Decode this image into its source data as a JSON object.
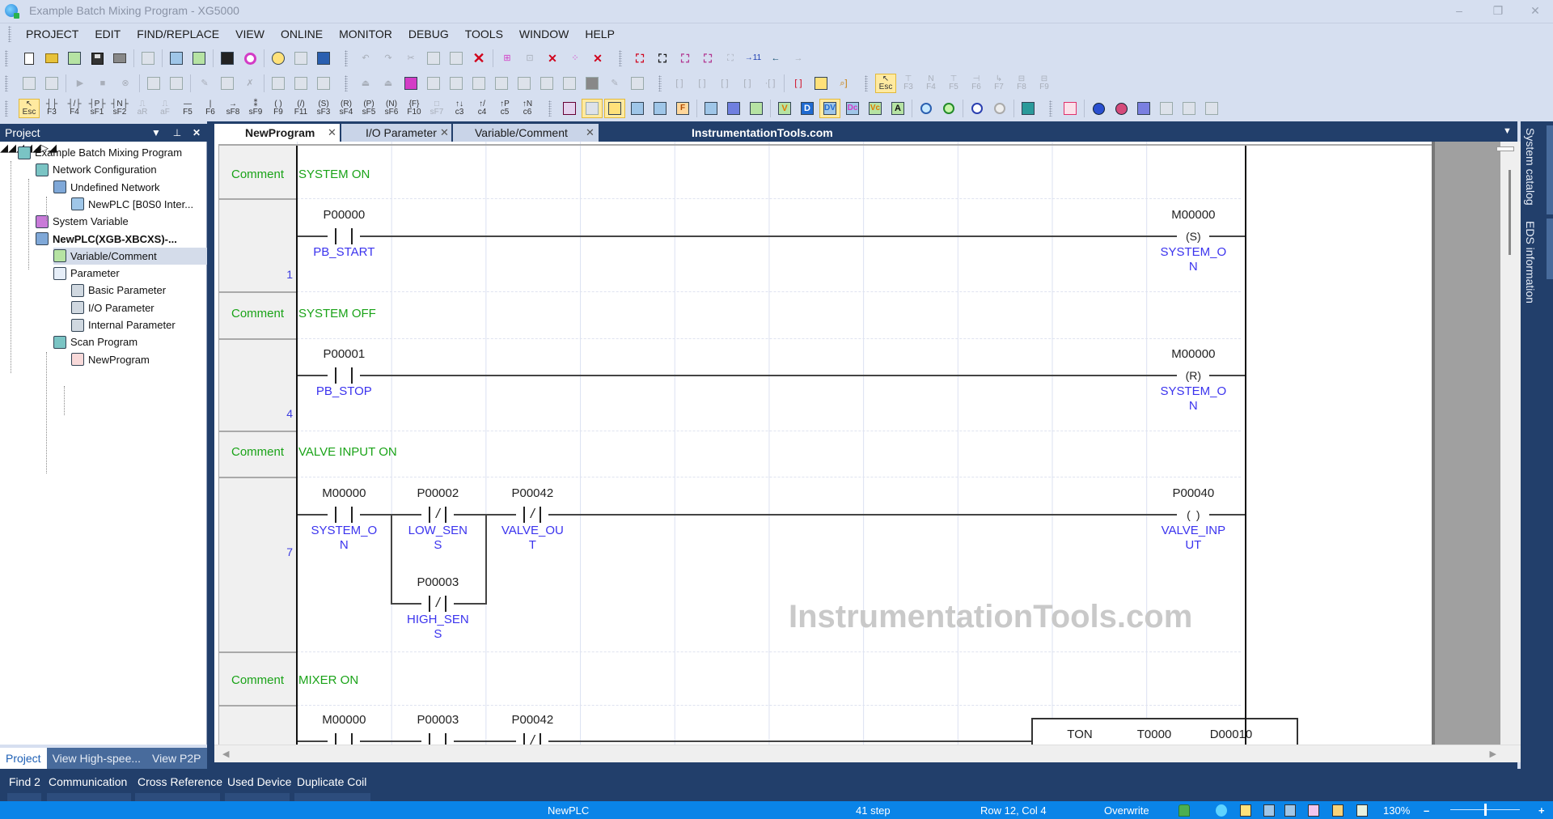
{
  "window": {
    "title": "Example  Batch Mixing Program - XG5000",
    "controls": {
      "minimize": "–",
      "restore": "❐",
      "close": "✕"
    }
  },
  "menu": [
    "PROJECT",
    "EDIT",
    "FIND/REPLACE",
    "VIEW",
    "ONLINE",
    "MONITOR",
    "DEBUG",
    "TOOLS",
    "WINDOW",
    "HELP"
  ],
  "toolbar_ladder_keys": [
    {
      "glyph": "↖",
      "key": "Esc",
      "active": true
    },
    {
      "glyph": "┤├",
      "key": "F3"
    },
    {
      "glyph": "┤/├",
      "key": "F4"
    },
    {
      "glyph": "┤P├",
      "key": "sF1"
    },
    {
      "glyph": "┤N├",
      "key": "sF2"
    },
    {
      "glyph": "⎍",
      "key": "aR",
      "disabled": true
    },
    {
      "glyph": "⎍",
      "key": "aF",
      "disabled": true
    },
    {
      "glyph": "—",
      "key": "F5"
    },
    {
      "glyph": "|",
      "key": "F6"
    },
    {
      "glyph": "→",
      "key": "sF8"
    },
    {
      "glyph": "⁑",
      "key": "sF9"
    },
    {
      "glyph": "( )",
      "key": "F9"
    },
    {
      "glyph": "(/)",
      "key": "F11"
    },
    {
      "glyph": "(S)",
      "key": "sF3"
    },
    {
      "glyph": "(R)",
      "key": "sF4"
    },
    {
      "glyph": "(P)",
      "key": "sF5"
    },
    {
      "glyph": "(N)",
      "key": "sF6"
    },
    {
      "glyph": "{F}",
      "key": "F10"
    },
    {
      "glyph": "□",
      "key": "sF7",
      "disabled": true
    },
    {
      "glyph": "↑↓",
      "key": "c3"
    },
    {
      "glyph": "↑/",
      "key": "c4"
    },
    {
      "glyph": "↑P",
      "key": "c5"
    },
    {
      "glyph": "↑N",
      "key": "c6"
    }
  ],
  "toolbar_block_keys": [
    {
      "glyph": "↖",
      "key": "Esc",
      "active": true
    },
    {
      "glyph": "⊤",
      "key": "F3",
      "disabled": true
    },
    {
      "glyph": "N",
      "key": "F4",
      "disabled": true
    },
    {
      "glyph": "⊤",
      "key": "F5",
      "disabled": true
    },
    {
      "glyph": "⊣",
      "key": "F6",
      "disabled": true
    },
    {
      "glyph": "↳",
      "key": "F7",
      "disabled": true
    },
    {
      "glyph": "⊟",
      "key": "F8",
      "disabled": true
    },
    {
      "glyph": "⊟",
      "key": "F9",
      "disabled": true
    }
  ],
  "project_panel": {
    "title": "Project",
    "tree": [
      {
        "label": "Example  Batch Mixing Program",
        "level": 0,
        "icon": "project-icon",
        "expanded": true
      },
      {
        "label": "Network Configuration",
        "level": 1,
        "icon": "network-config-icon",
        "expanded": true
      },
      {
        "label": "Undefined Network",
        "level": 2,
        "icon": "network-icon",
        "expanded": true
      },
      {
        "label": "NewPLC [B0S0 Inter...",
        "level": 3,
        "icon": "plc-station-icon"
      },
      {
        "label": "System Variable",
        "level": 1,
        "icon": "system-variable-icon"
      },
      {
        "label": "NewPLC(XGB-XBCXS)-...",
        "level": 1,
        "icon": "plc-icon",
        "expanded": true,
        "bold": true
      },
      {
        "label": "Variable/Comment",
        "level": 2,
        "icon": "variable-comment-icon",
        "selected": true
      },
      {
        "label": "Parameter",
        "level": 2,
        "icon": "parameter-icon",
        "expanded": true
      },
      {
        "label": "Basic Parameter",
        "level": 3,
        "icon": "basic-parameter-icon"
      },
      {
        "label": "I/O Parameter",
        "level": 3,
        "icon": "io-parameter-icon"
      },
      {
        "label": "Internal Parameter",
        "level": 3,
        "icon": "internal-parameter-icon",
        "collapsed": true
      },
      {
        "label": "Scan Program",
        "level": 2,
        "icon": "scan-program-icon",
        "expanded": true
      },
      {
        "label": "NewProgram",
        "level": 3,
        "icon": "ladder-program-icon"
      }
    ],
    "tabs": [
      "Project",
      "View High-spee...",
      "View P2P"
    ],
    "active_tab": "Project"
  },
  "editor": {
    "tabs": [
      {
        "label": "NewProgram",
        "active": true
      },
      {
        "label": "I/O Parameter"
      },
      {
        "label": "Variable/Comment"
      }
    ],
    "tab_watermark": "InstrumentationTools.com",
    "comment_label": "Comment",
    "watermark": "InstrumentationTools.com",
    "rungs": [
      {
        "comment": "SYSTEM ON",
        "step": "1",
        "contacts": [
          {
            "addr": "P00000",
            "name": "PB_START",
            "type": "NO"
          }
        ],
        "coil": {
          "addr": "M00000",
          "name": "SYSTEM_O\nN",
          "type": "S"
        }
      },
      {
        "comment": "SYSTEM OFF",
        "step": "4",
        "contacts": [
          {
            "addr": "P00001",
            "name": "PB_STOP",
            "type": "NO"
          }
        ],
        "coil": {
          "addr": "M00000",
          "name": "SYSTEM_O\nN",
          "type": "R"
        }
      },
      {
        "comment": "VALVE INPUT ON",
        "step": "7",
        "contacts": [
          {
            "addr": "M00000",
            "name": "SYSTEM_O\nN",
            "type": "NO"
          },
          {
            "addr": "P00002",
            "name": "LOW_SEN\nS",
            "type": "NC"
          },
          {
            "addr": "P00042",
            "name": "VALVE_OU\nT",
            "type": "NC"
          }
        ],
        "branch": {
          "addr": "P00003",
          "name": "HIGH_SEN\nS",
          "type": "NC"
        },
        "coil": {
          "addr": "P00040",
          "name": "VALVE_INP\nUT",
          "type": ""
        }
      },
      {
        "comment": "MIXER ON",
        "step": "",
        "contacts": [
          {
            "addr": "M00000",
            "type": "NO"
          },
          {
            "addr": "P00003",
            "type": "NO"
          },
          {
            "addr": "P00042",
            "type": "NC"
          }
        ],
        "function_block": {
          "instr": "TON",
          "timer": "T0000",
          "preset": "D00010"
        }
      }
    ]
  },
  "side_tabs": [
    "System catalog",
    "EDS information"
  ],
  "bottom_tabs": [
    "Find 2",
    "Communication",
    "Cross Reference",
    "Used Device",
    "Duplicate Coil"
  ],
  "status": {
    "plc": "NewPLC",
    "steps": "41 step",
    "position": "Row 12, Col 4",
    "mode": "Overwrite",
    "zoom": "130%",
    "zoom_minus": "–",
    "zoom_plus": "+",
    "zoom_fraction": 0.5
  },
  "colors": {
    "accent_dark": "#223f6b",
    "status_bar": "#0a84e8",
    "comment_text": "#1aa318",
    "variable_text": "#3b33ee"
  }
}
